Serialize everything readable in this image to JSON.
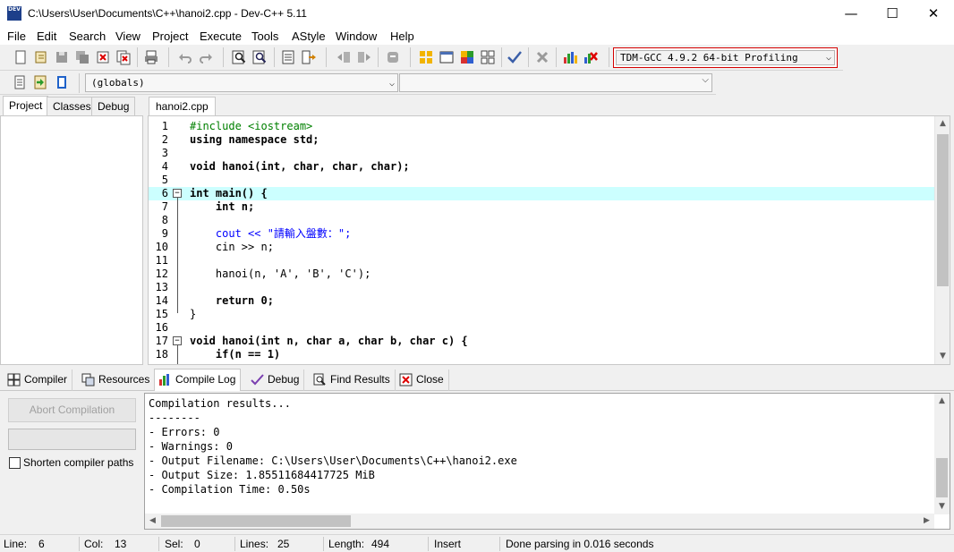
{
  "window": {
    "title": "C:\\Users\\User\\Documents\\C++\\hanoi2.cpp - Dev-C++ 5.11",
    "app_icon_text": "DEV",
    "minimize_glyph": "—",
    "maximize_glyph": "☐",
    "close_glyph": "✕"
  },
  "menu": [
    "File",
    "Edit",
    "Search",
    "View",
    "Project",
    "Execute",
    "Tools",
    "AStyle",
    "Window",
    "Help"
  ],
  "toolbar": {
    "compiler": "TDM-GCC 4.9.2 64-bit Profiling",
    "scope": "(globals)",
    "function": ""
  },
  "left_tabs": [
    "Project",
    "Classes",
    "Debug"
  ],
  "editor": {
    "file_tab": "hanoi2.cpp",
    "current_line": 6,
    "lines": [
      {
        "n": "1",
        "code": "#include <iostream>"
      },
      {
        "n": "2",
        "code": "using namespace std;"
      },
      {
        "n": "3",
        "code": ""
      },
      {
        "n": "4",
        "code": "void hanoi(int, char, char, char);"
      },
      {
        "n": "5",
        "code": ""
      },
      {
        "n": "6",
        "code": "int main() {"
      },
      {
        "n": "7",
        "code": "    int n;"
      },
      {
        "n": "8",
        "code": ""
      },
      {
        "n": "9",
        "code": "    cout << \"請輸入盤數：\";"
      },
      {
        "n": "10",
        "code": "    cin >> n;"
      },
      {
        "n": "11",
        "code": ""
      },
      {
        "n": "12",
        "code": "    hanoi(n, 'A', 'B', 'C');"
      },
      {
        "n": "13",
        "code": ""
      },
      {
        "n": "14",
        "code": "    return 0;"
      },
      {
        "n": "15",
        "code": "}"
      },
      {
        "n": "16",
        "code": ""
      },
      {
        "n": "17",
        "code": "void hanoi(int n, char a, char b, char c) {"
      },
      {
        "n": "18",
        "code": "    if(n == 1)"
      }
    ]
  },
  "bottom_tabs": [
    "Compiler",
    "Resources",
    "Compile Log",
    "Debug",
    "Find Results",
    "Close"
  ],
  "compile_panel": {
    "abort_button": "Abort Compilation",
    "shorten_paths_label": "Shorten compiler paths",
    "shorten_paths_checked": false
  },
  "compile_log": [
    "Compilation results...",
    "--------",
    "- Errors: 0",
    "- Warnings: 0",
    "- Output Filename: C:\\Users\\User\\Documents\\C++\\hanoi2.exe",
    "- Output Size: 1.85511684417725 MiB",
    "- Compilation Time: 0.50s"
  ],
  "status": {
    "line_label": "Line:",
    "line_value": "6",
    "col_label": "Col:",
    "col_value": "13",
    "sel_label": "Sel:",
    "sel_value": "0",
    "lines_label": "Lines:",
    "lines_value": "25",
    "length_label": "Length:",
    "length_value": "494",
    "mode": "Insert",
    "message": "Done parsing in 0.016 seconds"
  }
}
